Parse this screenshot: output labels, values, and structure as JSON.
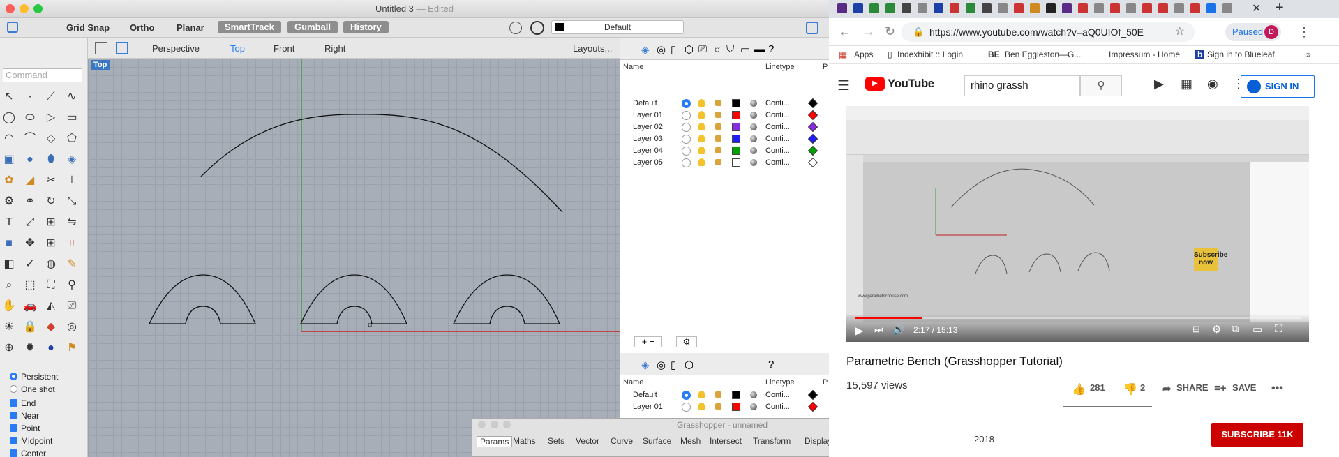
{
  "rhino": {
    "title": "Untitled 3",
    "edited": "— Edited",
    "toolbar": {
      "grid_snap": "Grid Snap",
      "ortho": "Ortho",
      "planar": "Planar",
      "smarttrack": "SmartTrack",
      "gumball": "Gumball",
      "history": "History",
      "current_layer": "Default"
    },
    "command_placeholder": "Command",
    "viewport_tabs": [
      "Perspective",
      "Top",
      "Front",
      "Right"
    ],
    "layouts_label": "Layouts...",
    "viewport_label": "Top",
    "osnap": {
      "persistent": "Persistent",
      "one_shot": "One shot",
      "end": "End",
      "near": "Near",
      "point": "Point",
      "midpoint": "Midpoint",
      "center": "Center"
    },
    "layers_panel": {
      "col_name": "Name",
      "col_linetype": "Linetype",
      "col_p": "P",
      "rows": [
        {
          "name": "Default",
          "color": "#000000",
          "linetype": "Conti...",
          "current": true
        },
        {
          "name": "Layer 01",
          "color": "#ff0000",
          "linetype": "Conti...",
          "current": false
        },
        {
          "name": "Layer 02",
          "color": "#8a2be2",
          "linetype": "Conti...",
          "current": false
        },
        {
          "name": "Layer 03",
          "color": "#1e1eff",
          "linetype": "Conti...",
          "current": false
        },
        {
          "name": "Layer 04",
          "color": "#00a000",
          "linetype": "Conti...",
          "current": false
        },
        {
          "name": "Layer 05",
          "color": "#ffffff",
          "linetype": "Conti...",
          "current": false
        }
      ],
      "rows2": [
        {
          "name": "Default",
          "color": "#000000",
          "linetype": "Conti...",
          "current": true
        },
        {
          "name": "Layer 01",
          "color": "#ff0000",
          "linetype": "Conti...",
          "current": false
        }
      ]
    }
  },
  "grasshopper": {
    "title": "Grasshopper - unnamed",
    "tabs": [
      "Params",
      "Maths",
      "Sets",
      "Vector",
      "Curve",
      "Surface",
      "Mesh",
      "Intersect",
      "Transform",
      "Display"
    ]
  },
  "chrome": {
    "url": "https://www.youtube.com/watch?v=aQ0UIOf_50E",
    "paused_label": "Paused",
    "profile_initial": "D",
    "bookmarks": [
      "Apps",
      "Indexhibit :: Login",
      "Ben Eggleston—G...",
      "Impressum - Home",
      "Sign in to Blueleaf"
    ],
    "bookmark_be": "BE"
  },
  "youtube": {
    "logo": "YouTube",
    "search_value": "rhino grassh",
    "sign_in": "SIGN IN",
    "video_time": "2:17 / 15:13",
    "subscribe_overlay": "Subscribe now",
    "site_watermark": "www.parametrichouse.com",
    "video_title": "Parametric Bench (Grasshopper Tutorial)",
    "views": "15,597 views",
    "likes": "281",
    "dislikes": "2",
    "share": "SHARE",
    "save": "SAVE",
    "subscribe": "SUBSCRIBE 11K",
    "published": "2018"
  }
}
